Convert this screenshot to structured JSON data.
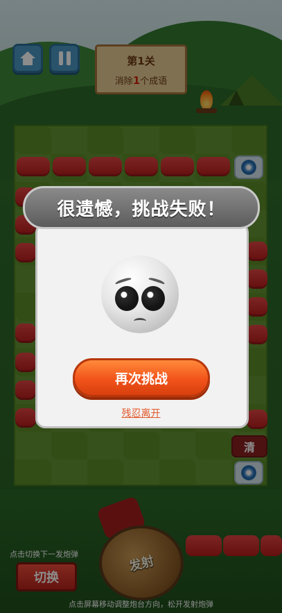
{
  "header": {
    "home_icon": "home-icon",
    "pause_icon": "pause-icon",
    "level_title": "第1关",
    "goal_prefix": "消除",
    "goal_count": "1",
    "goal_suffix": "个成语"
  },
  "board": {
    "clear_label": "清"
  },
  "controls": {
    "switch_hint": "点击切换下一发炮弹",
    "switch_label": "切换",
    "fire_label": "发射",
    "footer_hint": "点击屏幕移动调整炮台方向，松开发射炮弹"
  },
  "dialog": {
    "title": "很遗憾，挑战失败！",
    "emoji": "pleading-face",
    "retry_label": "再次挑战",
    "leave_label": "残忍离开"
  },
  "colors": {
    "accent_orange": "#f2531a",
    "tile_red": "#c42626",
    "board_green": "#5b8d27"
  }
}
